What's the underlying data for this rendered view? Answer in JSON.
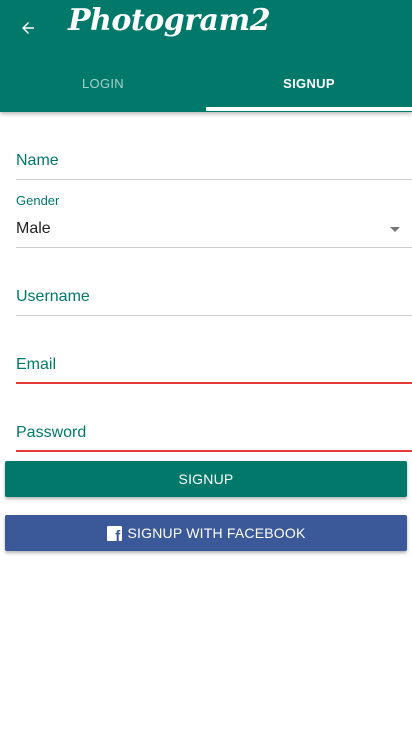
{
  "app": {
    "title": "Photogram2",
    "back_icon": "arrow-left-icon"
  },
  "tabs": [
    {
      "label": "LOGIN",
      "selected": false
    },
    {
      "label": "SIGNUP",
      "selected": true
    }
  ],
  "form": {
    "name_label": "Name",
    "gender_label": "Gender",
    "gender_value": "Male",
    "username_label": "Username",
    "email_label": "Email",
    "password_label": "Password"
  },
  "buttons": {
    "signup": "SIGNUP",
    "facebook": "SIGNUP WITH FACEBOOK",
    "facebook_icon": "facebook-icon"
  },
  "colors": {
    "primary": "#00796b",
    "error": "#e53935",
    "facebook": "#3b5998"
  }
}
